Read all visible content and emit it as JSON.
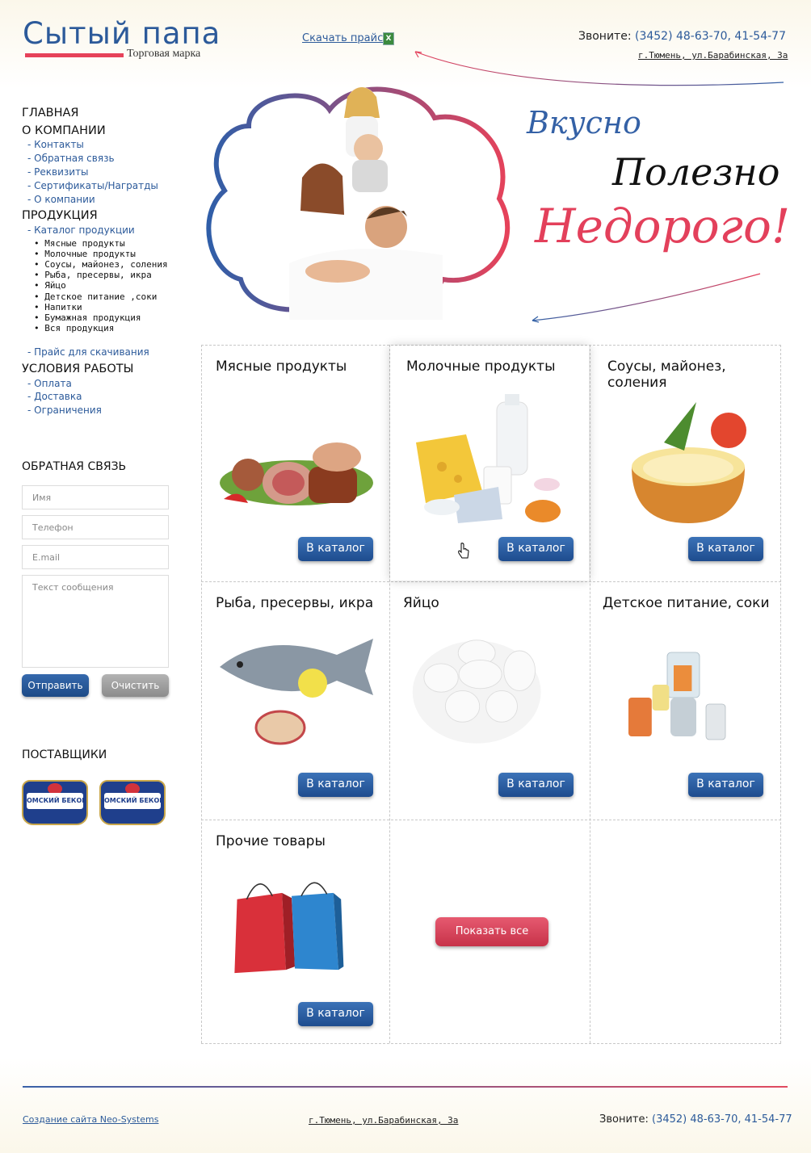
{
  "header": {
    "logo_name": "Сытый папа",
    "logo_sub": "Торговая марка",
    "price_link": "Скачать прайс",
    "phone_label": "Звоните:",
    "phone_numbers": "(3452) 48-63-70, 41-54-77",
    "address": "г.Тюмень, ул.Барабинская, 3а"
  },
  "hero": {
    "slogan_1": "Вкусно",
    "slogan_2": "Полезно",
    "slogan_3": "Недорого!"
  },
  "nav": {
    "main": "ГЛАВНАЯ",
    "company": "О КОМПАНИИ",
    "company_items": [
      "- Контакты",
      "- Обратная связь",
      "- Реквизиты",
      "- Сертификаты/Награтды",
      "- О компании"
    ],
    "products": "ПРОДУКЦИЯ",
    "catalog": "- Каталог продукции",
    "catalog_items": [
      "• Мясные продукты",
      "• Молочные продукты",
      "• Соусы, майонез, соления",
      "• Рыба, пресервы, икра",
      "• Яйцо",
      "• Детское питание ,соки",
      "• Напитки",
      "• Бумажная продукция",
      "• Вся продукция"
    ],
    "price_download": "- Прайс для скачивания",
    "terms": "УСЛОВИЯ РАБОТЫ",
    "terms_items": [
      "- Оплата",
      "- Доставка",
      "- Ограничения"
    ]
  },
  "feedback": {
    "title": "ОБРАТНАЯ СВЯЗЬ",
    "name_placeholder": "Имя",
    "phone_placeholder": "Телефон",
    "email_placeholder": "E.mail",
    "message_placeholder": "Текст сообщения",
    "send": "Отправить",
    "clear": "Очистить"
  },
  "suppliers": {
    "title": "ПОСТАВЩИКИ",
    "logos": [
      "ОМСКИЙ БЕКОН",
      "ОМСКИЙ БЕКОН"
    ]
  },
  "catalog": {
    "button_label": "В каталог",
    "show_all": "Показать все",
    "items": [
      {
        "title": "Мясные продукты",
        "icon": "meat-products-image"
      },
      {
        "title": "Молочные продукты",
        "icon": "dairy-products-image"
      },
      {
        "title": "Соусы, майонез, соления",
        "icon": "sauce-bowl-image"
      },
      {
        "title": "Рыба, пресервы, икра",
        "icon": "fish-image"
      },
      {
        "title": "Яйцо",
        "icon": "eggs-image"
      },
      {
        "title": "Детское питание, соки",
        "icon": "baby-food-image"
      },
      {
        "title": "Прочие товары",
        "icon": "shopping-bags-image"
      }
    ]
  },
  "footer": {
    "credit": "Создание сайта Neo-Systems",
    "address": "г.Тюмень, ул.Барабинская, 3а",
    "phone_label": "Звоните:",
    "phone_numbers": "(3452) 48-63-70, 41-54-77"
  },
  "colors": {
    "brand_blue": "#2c5a9a",
    "brand_red": "#e3405b"
  }
}
